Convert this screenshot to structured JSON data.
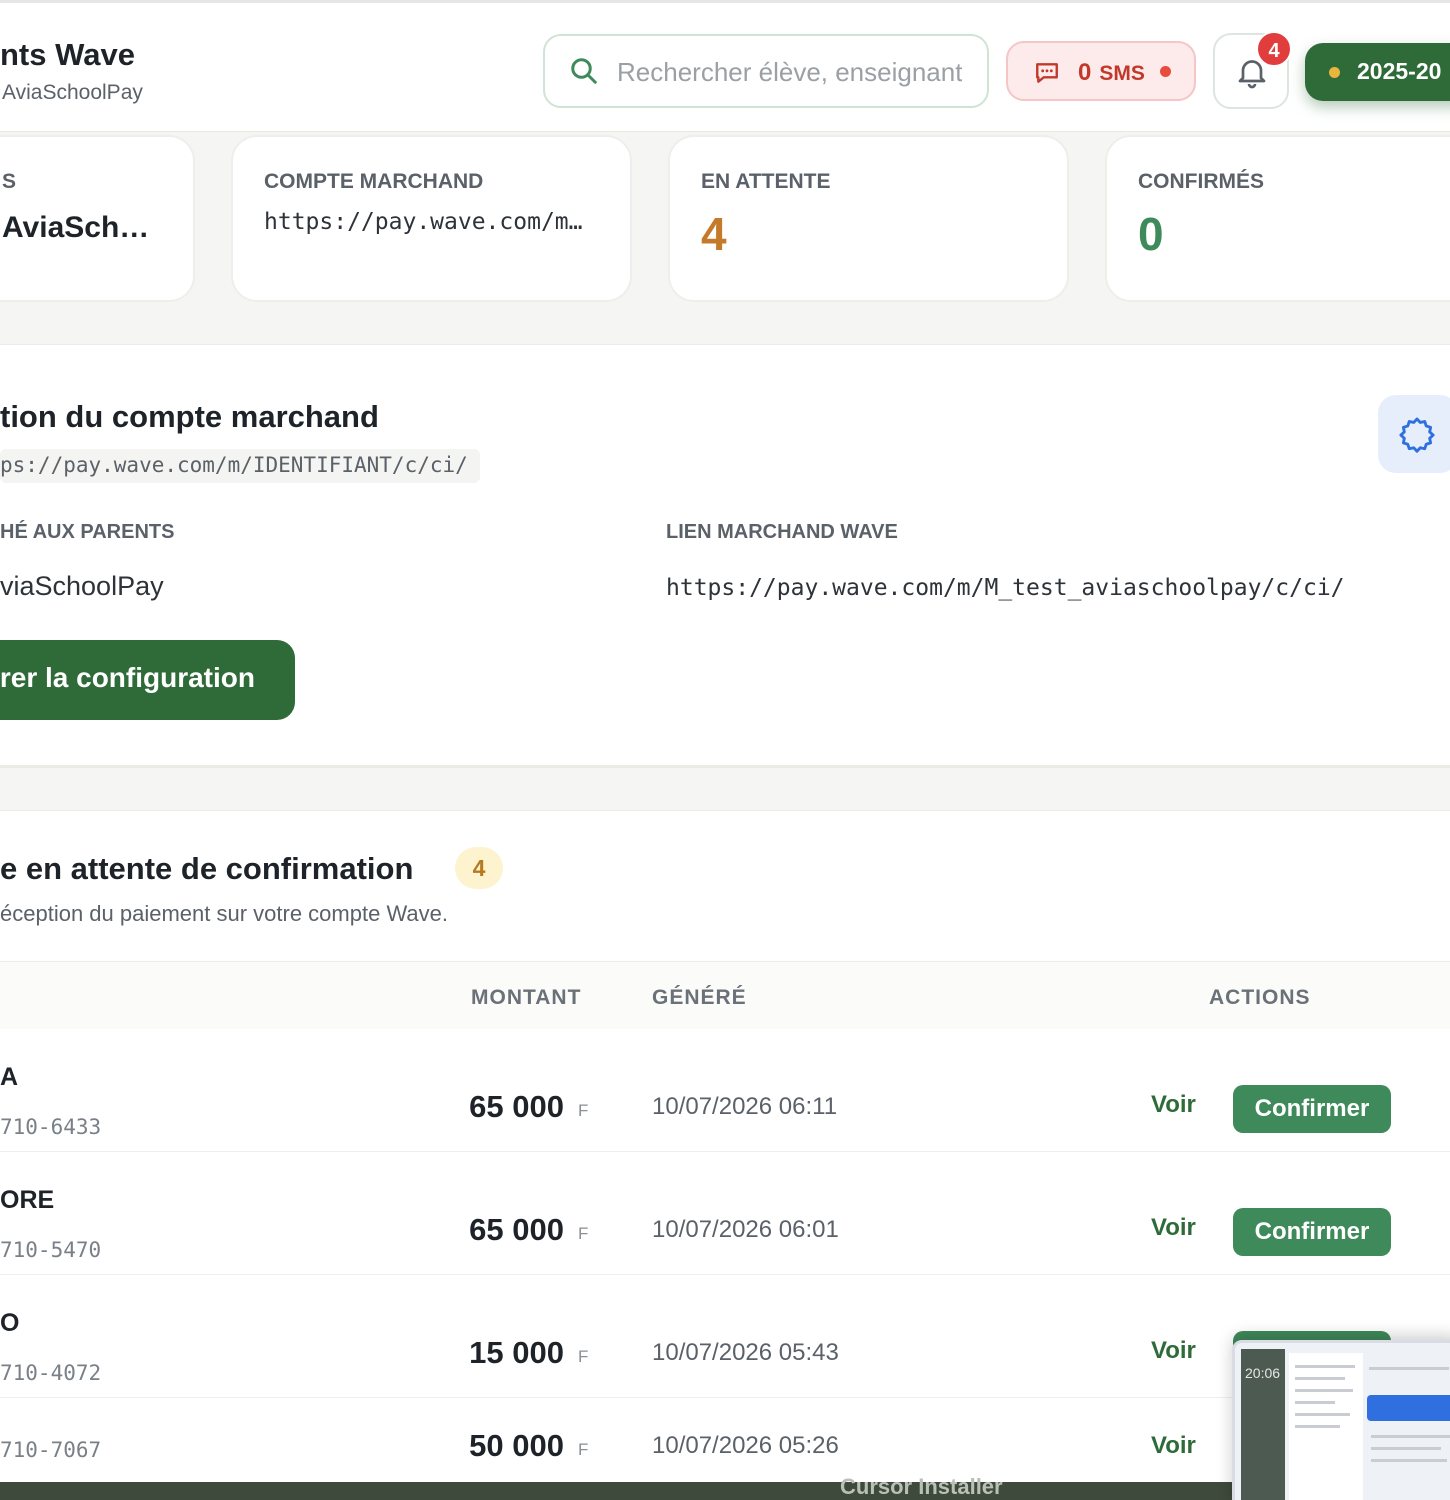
{
  "header": {
    "title": "nts Wave",
    "subtitle": "AviaSchoolPay",
    "search": {
      "placeholder": "Rechercher élève, enseignant…",
      "value": ""
    },
    "sms": {
      "count": "0",
      "label": "SMS"
    },
    "notifications": {
      "count": "4"
    },
    "year": {
      "label": "2025-20"
    }
  },
  "stats": [
    {
      "label": "S",
      "value": "AviaSch…"
    },
    {
      "label": "COMPTE MARCHAND",
      "value": "https://pay.wave.com/m…"
    },
    {
      "label": "EN ATTENTE",
      "value": "4"
    },
    {
      "label": "CONFIRMÉS",
      "value": "0"
    }
  ],
  "config": {
    "title": "tion du compte marchand",
    "url_hint": "ps://pay.wave.com/m/IDENTIFIANT/c/ci/",
    "display_label": "HÉ AUX PARENTS",
    "display_value": "viaSchoolPay",
    "link_label": "LIEN MARCHAND WAVE",
    "link_value": "https://pay.wave.com/m/M_test_aviaschoolpay/c/ci/",
    "save_label": "rer la configuration"
  },
  "pending": {
    "title": "e en attente de confirmation",
    "count": "4",
    "subtitle": "éception du paiement sur votre compte Wave.",
    "columns": {
      "amount": "MONTANT",
      "generated": "GÉNÉRÉ",
      "actions": "ACTIONS"
    },
    "rows": [
      {
        "name": "A",
        "ref": "710-6433",
        "amount": "65 000",
        "currency": "F",
        "date": "10/07/2026 06:11",
        "view": "Voir",
        "confirm": "Confirmer"
      },
      {
        "name": "ORE",
        "ref": "710-5470",
        "amount": "65 000",
        "currency": "F",
        "date": "10/07/2026 06:01",
        "view": "Voir",
        "confirm": "Confirmer"
      },
      {
        "name": "O",
        "ref": "710-4072",
        "amount": "15 000",
        "currency": "F",
        "date": "10/07/2026 05:43",
        "view": "Voir",
        "confirm": "Confirmer"
      },
      {
        "name": "",
        "ref": "710-7067",
        "amount": "50 000",
        "currency": "F",
        "date": "10/07/2026 05:26",
        "view": "Voir",
        "confirm": ""
      }
    ]
  },
  "overlay": {
    "time": "20:06",
    "bottom_text": "Cursor Installer"
  },
  "colors": {
    "primary": "#2f6b39",
    "pending": "#c47a2a",
    "confirmed": "#3f8a5a",
    "danger": "#e23d3d"
  }
}
